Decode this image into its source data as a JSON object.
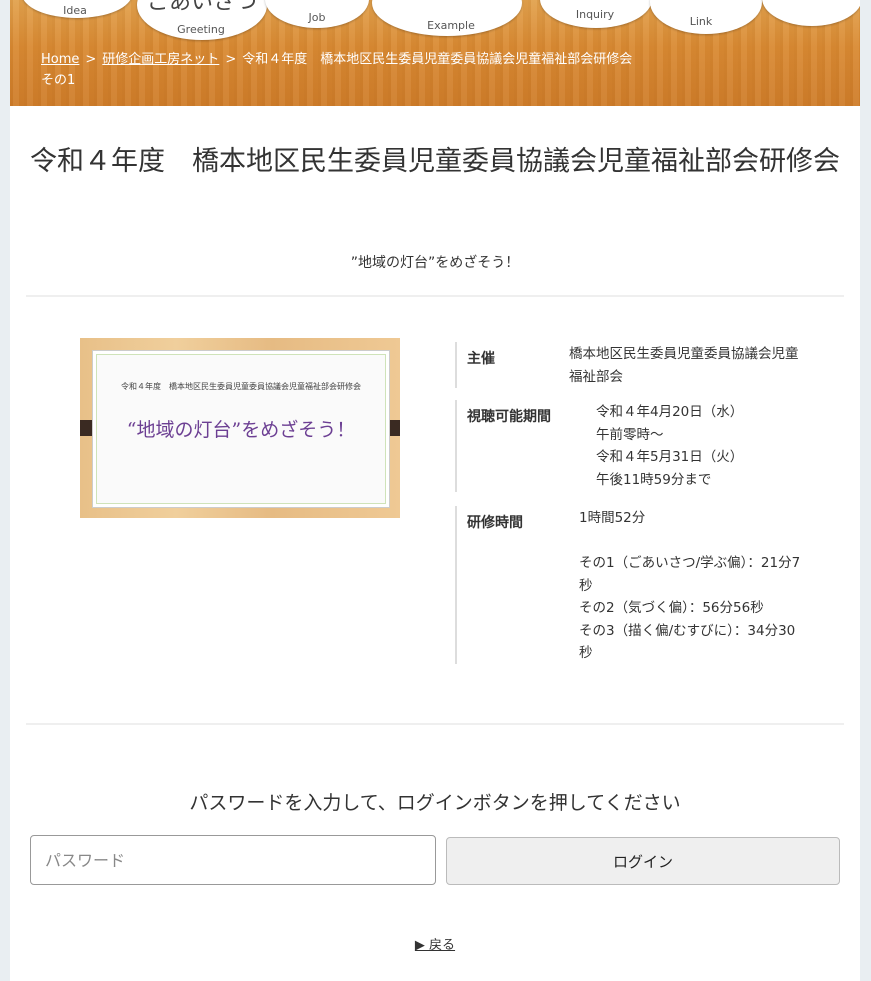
{
  "nav": {
    "items": [
      {
        "label": "Idea"
      },
      {
        "label": "ごあいさつ",
        "sub": "Greeting"
      },
      {
        "label": "Job"
      },
      {
        "label": "Example"
      },
      {
        "label": "Inquiry"
      },
      {
        "label": "Link"
      }
    ]
  },
  "breadcrumb": {
    "home": "Home",
    "sep": ">",
    "parent": "研修企画工房ネット",
    "current": "令和４年度　橋本地区民生委員児童委員協議会児童福祉部会研修会　その1"
  },
  "page": {
    "title": "令和４年度　橋本地区民生委員児童委員協議会児童福祉部会研修会",
    "subtitle": "”地域の灯台”をめざそう！"
  },
  "thumbnail": {
    "small_text": "令和４年度　橋本地区民生委員児童委員協議会児童福祉部会研修会",
    "main_text": "“地域の灯台”をめざそう！"
  },
  "info": {
    "organizer_label": "主催",
    "organizer_value": "橋本地区民生委員児童委員協議会児童福祉部会",
    "period_label": "視聴可能期間",
    "period_lines": [
      "令和４年4月20日（水）",
      "午前零時～",
      "令和４年5月31日（火）",
      "午後11時59分まで"
    ],
    "time_label": "研修時間",
    "time_lines": [
      "1時間52分",
      "",
      "その1（ごあいさつ/学ぶ偏）：21分7秒",
      "その2（気づく偏）：56分56秒",
      "その3（描く偏/むすびに）：34分30秒"
    ]
  },
  "login": {
    "prompt": "パスワードを入力して、ログインボタンを押してください",
    "placeholder": "パスワード",
    "button": "ログイン"
  },
  "back": "▶ 戻る"
}
